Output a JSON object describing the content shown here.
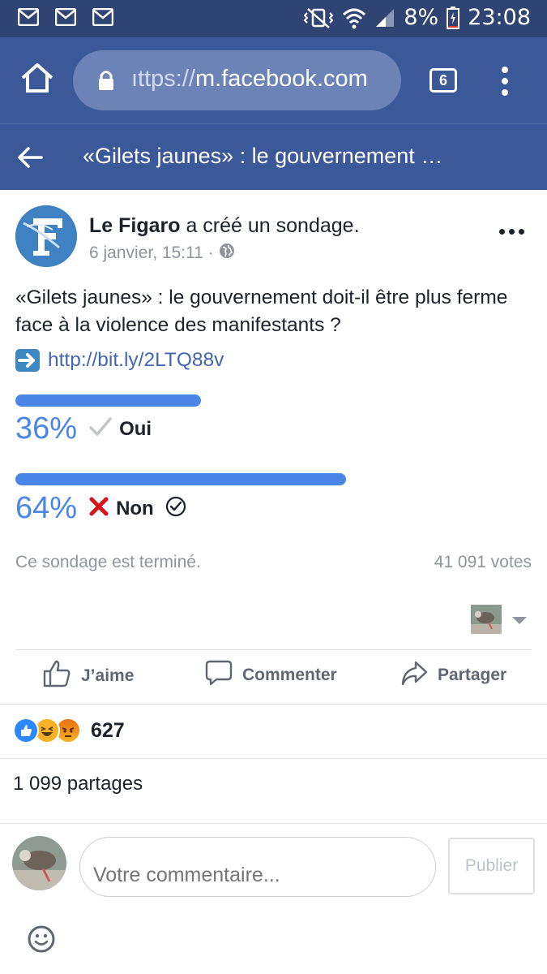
{
  "status_bar": {
    "notification_icons": [
      "gmail-icon",
      "gmail-icon",
      "gmail-icon"
    ],
    "battery": "8%",
    "time": "23:08"
  },
  "browser": {
    "url_prefix": "ıttps://",
    "url_domain": "m.facebook.com",
    "tab_count": "6"
  },
  "page_header": {
    "title": "«Gilets jaunes» : le gouvernement …"
  },
  "post": {
    "author": "Le Figaro",
    "action_text": " a créé un sondage.",
    "date": "6 janvier, 15:11 ·",
    "question": "«Gilets jaunes» : le gouvernement doit-il être plus ferme face à la violence des manifestants ?",
    "link": "http://bit.ly/2LTQ88v"
  },
  "poll": {
    "options": [
      {
        "percent_label": "36%",
        "label": "Oui",
        "share": 0.36,
        "voted_by_user": false
      },
      {
        "percent_label": "64%",
        "label": "Non",
        "share": 0.64,
        "voted_by_user": true
      }
    ],
    "status": "Ce sondage est terminé.",
    "votes": "41 091 votes"
  },
  "actions": {
    "like": "J’aime",
    "comment": "Commenter",
    "share": "Partager"
  },
  "reactions": {
    "types": [
      "like",
      "haha",
      "angry"
    ],
    "count": "627"
  },
  "shares": "1 099 partages",
  "comment_box": {
    "placeholder": "Votre commentaire...",
    "publish": "Publier"
  },
  "colors": {
    "facebook_blue": "#3b5998",
    "status_bar": "#2f4473",
    "poll_blue": "#4a86e8",
    "link_blue": "#4267b2"
  }
}
